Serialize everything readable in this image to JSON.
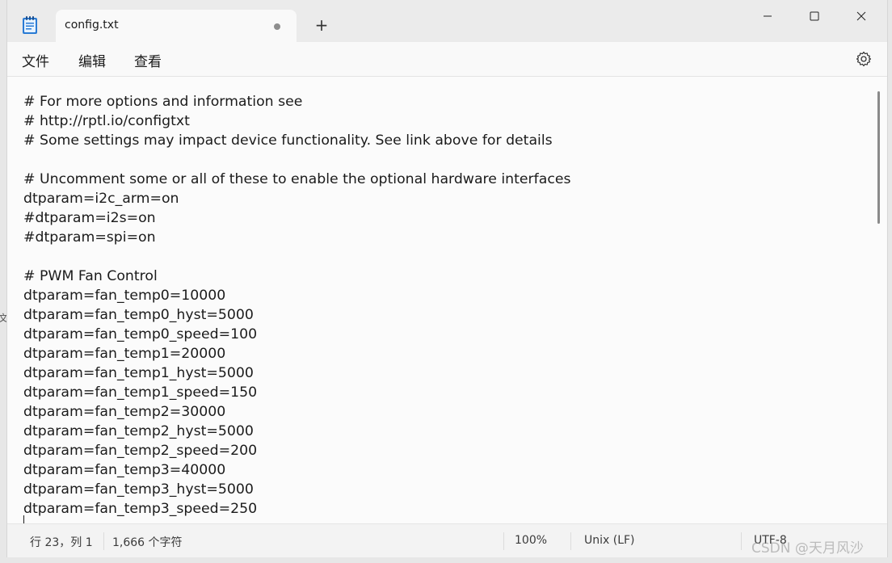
{
  "window": {
    "tab_title": "config.txt",
    "new_tab_glyph": "+",
    "app_icon": "notepad-icon"
  },
  "menu": {
    "file": "文件",
    "edit": "编辑",
    "view": "查看"
  },
  "editor": {
    "lines": [
      "# For more options and information see",
      "# http://rptl.io/configtxt",
      "# Some settings may impact device functionality. See link above for details",
      "",
      "# Uncomment some or all of these to enable the optional hardware interfaces",
      "dtparam=i2c_arm=on",
      "#dtparam=i2s=on",
      "#dtparam=spi=on",
      "",
      "# PWM Fan Control",
      "dtparam=fan_temp0=10000",
      "dtparam=fan_temp0_hyst=5000",
      "dtparam=fan_temp0_speed=100",
      "dtparam=fan_temp1=20000",
      "dtparam=fan_temp1_hyst=5000",
      "dtparam=fan_temp1_speed=150",
      "dtparam=fan_temp2=30000",
      "dtparam=fan_temp2_hyst=5000",
      "dtparam=fan_temp2_speed=200",
      "dtparam=fan_temp3=40000",
      "dtparam=fan_temp3_hyst=5000",
      "dtparam=fan_temp3_speed=250"
    ]
  },
  "status": {
    "position": "行 23，列 1",
    "char_count": "1,666 个字符",
    "zoom": "100%",
    "line_ending": "Unix (LF)",
    "encoding": "UTF-8"
  },
  "watermark": "CSDN @天月风沙",
  "edge_char": "文"
}
